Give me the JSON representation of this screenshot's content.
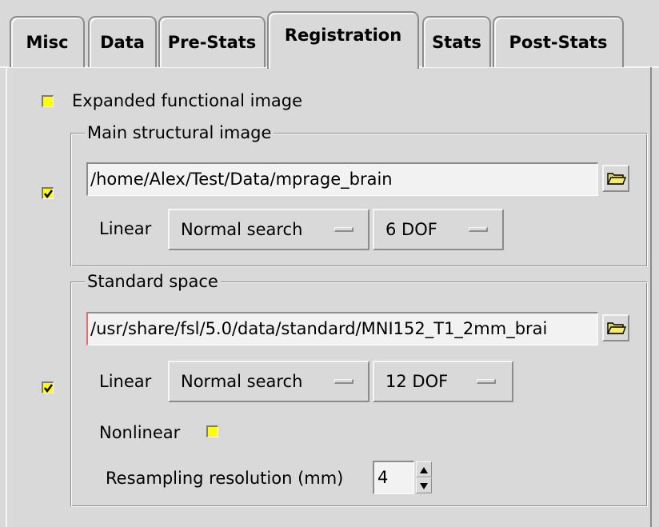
{
  "tabs": [
    {
      "label": "Misc",
      "active": false
    },
    {
      "label": "Data",
      "active": false
    },
    {
      "label": "Pre-Stats",
      "active": false
    },
    {
      "label": "Registration",
      "active": true
    },
    {
      "label": "Stats",
      "active": false
    },
    {
      "label": "Post-Stats",
      "active": false
    }
  ],
  "expanded": {
    "label": "Expanded functional image",
    "checked": false
  },
  "main_structural": {
    "title": "Main structural image",
    "enabled": true,
    "path": "/home/Alex/Test/Data/mprage_brain",
    "linear_label": "Linear",
    "search": "Normal search",
    "dof": "6 DOF"
  },
  "standard": {
    "title": "Standard space",
    "enabled": true,
    "path": "/usr/share/fsl/5.0/data/standard/MNI152_T1_2mm_brai",
    "linear_label": "Linear",
    "search": "Normal search",
    "dof": "12 DOF",
    "nonlinear_label": "Nonlinear",
    "nonlinear_checked": false,
    "resampling_label": "Resampling resolution (mm)",
    "resampling_value": "4"
  },
  "colors": {
    "checkbox": "#ffff00",
    "background": "#d9d9d9",
    "entry": "#f2f2f2"
  },
  "icons": [
    "folder-icon",
    "check-icon",
    "spin-up-icon",
    "spin-down-icon"
  ]
}
